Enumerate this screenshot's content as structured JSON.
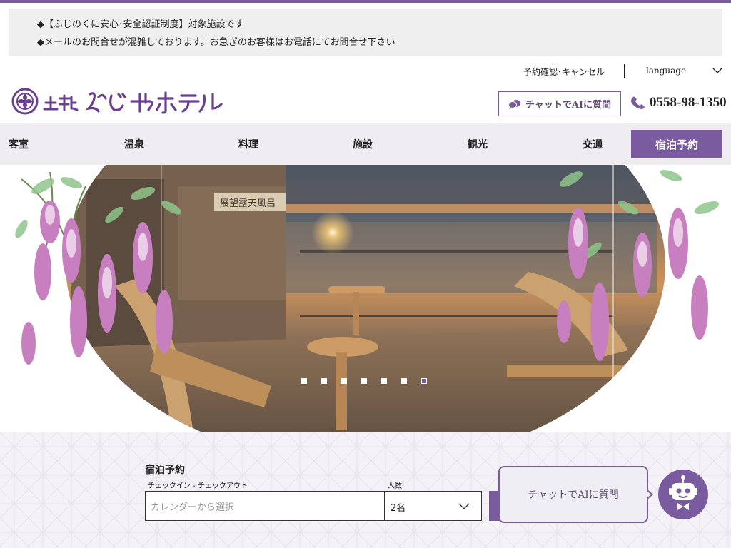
{
  "colors": {
    "accent": "#7b5ba0",
    "nav_bg": "#efecf2",
    "notice_bg": "#efefef"
  },
  "notice": {
    "line1": "◆【ふじのくに安心･安全認証制度】対象施設です",
    "line2": "◆メールのお問合せが混雑しております。お急ぎのお客様はお電話にてお問合せ下さい"
  },
  "util": {
    "reserve_link": "予約確認･キャンセル",
    "language": "language"
  },
  "header": {
    "logo_alt": "土肥 ふじやホテル",
    "chat_button": "チャットでAIに質問",
    "phone": "0558-98-1350"
  },
  "nav": {
    "items": [
      "客室",
      "温泉",
      "料理",
      "施設",
      "観光",
      "交通"
    ],
    "book": "宿泊予約"
  },
  "hero": {
    "slide_count": 7,
    "active_slide": 7,
    "sign_text": "展望露天風呂"
  },
  "booking": {
    "title": "宿泊予約",
    "date_label": "チェックイン - チェックアウト",
    "date_placeholder": "カレンダーから選択",
    "guests_label": "人数",
    "guests_value": "2名"
  },
  "chat_widget": {
    "bubble_text": "チャットでAIに質問",
    "icon": "robot-icon"
  }
}
